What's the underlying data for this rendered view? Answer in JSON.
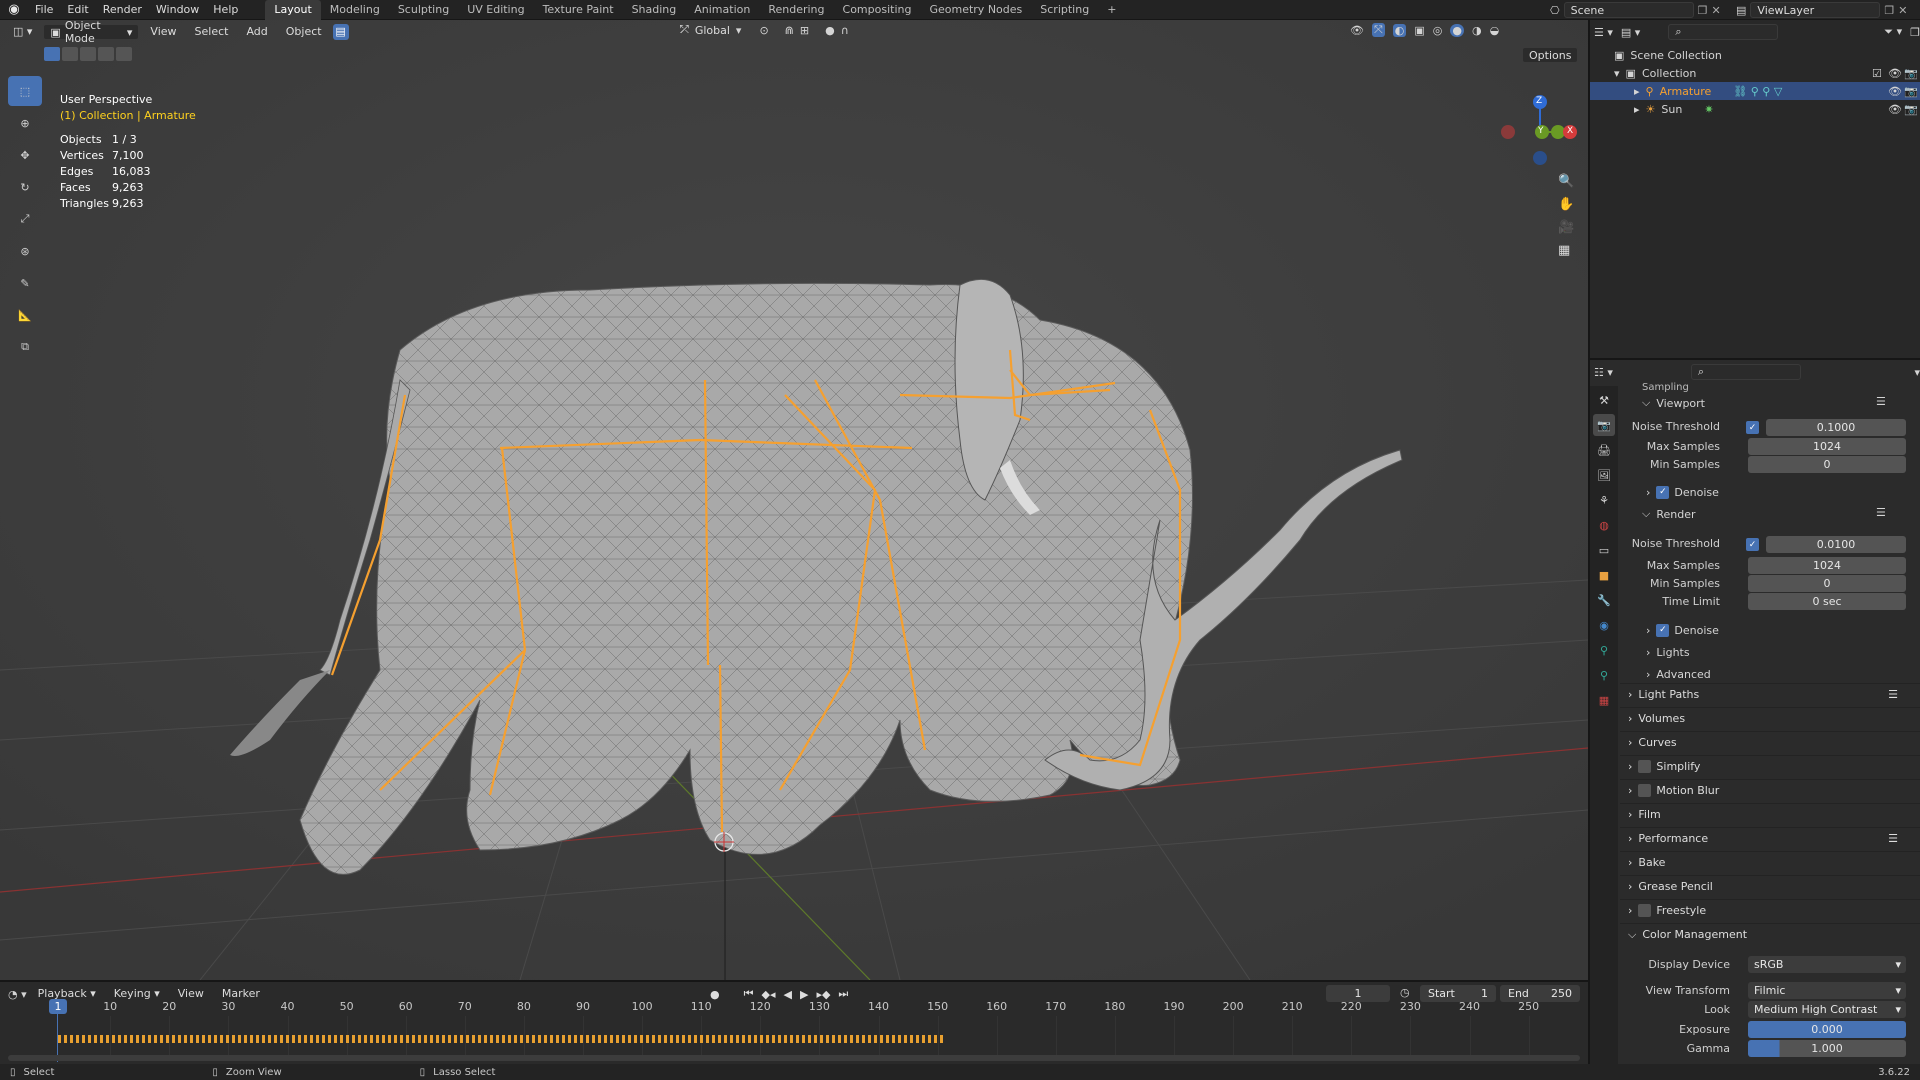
{
  "topbar": {
    "menus": [
      "File",
      "Edit",
      "Render",
      "Window",
      "Help"
    ],
    "workspaces": [
      "Layout",
      "Modeling",
      "Sculpting",
      "UV Editing",
      "Texture Paint",
      "Shading",
      "Animation",
      "Rendering",
      "Compositing",
      "Geometry Nodes",
      "Scripting"
    ],
    "active_workspace": "Layout",
    "add_tab": "+",
    "scene": "Scene",
    "view_layer": "ViewLayer"
  },
  "viewport": {
    "mode": "Object Mode",
    "menus": [
      "View",
      "Select",
      "Add",
      "Object"
    ],
    "transform_orientation": "Global",
    "options": "Options",
    "view_name": "User Perspective",
    "collection_line": "(1) Collection | Armature",
    "stats": [
      {
        "label": "Objects",
        "value": "1 / 3"
      },
      {
        "label": "Vertices",
        "value": "7,100"
      },
      {
        "label": "Edges",
        "value": "16,083"
      },
      {
        "label": "Faces",
        "value": "9,263"
      },
      {
        "label": "Triangles",
        "value": "9,263"
      }
    ],
    "gizmo": {
      "z": "Z",
      "y": "Y",
      "x": "X"
    }
  },
  "outliner": {
    "root": "Scene Collection",
    "collection": "Collection",
    "items": [
      {
        "name": "Armature",
        "selected": true
      },
      {
        "name": "Sun",
        "selected": false
      }
    ]
  },
  "properties": {
    "top_section": "Sampling",
    "viewport": {
      "title": "Viewport",
      "noise_threshold_label": "Noise Threshold",
      "noise_threshold": "0.1000",
      "max_samples_label": "Max Samples",
      "max_samples": "1024",
      "min_samples_label": "Min Samples",
      "min_samples": "0",
      "denoise": "Denoise"
    },
    "render": {
      "title": "Render",
      "noise_threshold_label": "Noise Threshold",
      "noise_threshold": "0.0100",
      "max_samples_label": "Max Samples",
      "max_samples": "1024",
      "min_samples_label": "Min Samples",
      "min_samples": "0",
      "time_limit_label": "Time Limit",
      "time_limit": "0 sec",
      "denoise": "Denoise",
      "lights": "Lights",
      "advanced": "Advanced"
    },
    "panels": [
      "Light Paths",
      "Volumes",
      "Curves",
      "Simplify",
      "Motion Blur",
      "Film",
      "Performance",
      "Bake",
      "Grease Pencil",
      "Freestyle"
    ],
    "color_management": {
      "title": "Color Management",
      "display_device_label": "Display Device",
      "display_device": "sRGB",
      "view_transform_label": "View Transform",
      "view_transform": "Filmic",
      "look_label": "Look",
      "look": "Medium High Contrast",
      "exposure_label": "Exposure",
      "exposure": "0.000",
      "gamma_label": "Gamma",
      "gamma": "1.000"
    }
  },
  "timeline": {
    "menus": [
      "Playback",
      "Keying",
      "View",
      "Marker"
    ],
    "current_frame": "1",
    "start_label": "Start",
    "start": "1",
    "end_label": "End",
    "end": "250",
    "ticks": [
      "10",
      "20",
      "30",
      "40",
      "50",
      "60",
      "70",
      "80",
      "90",
      "100",
      "110",
      "120",
      "130",
      "140",
      "150",
      "160",
      "170",
      "180",
      "190",
      "200",
      "210",
      "220",
      "230",
      "240",
      "250"
    ],
    "playhead": "1"
  },
  "statusbar": {
    "select": "Select",
    "zoom": "Zoom View",
    "lasso": "Lasso Select",
    "version": "3.6.22"
  },
  "colors": {
    "accent": "#4772b3",
    "bone": "#f5a030",
    "viewport_bg": "#3d3d3d"
  }
}
